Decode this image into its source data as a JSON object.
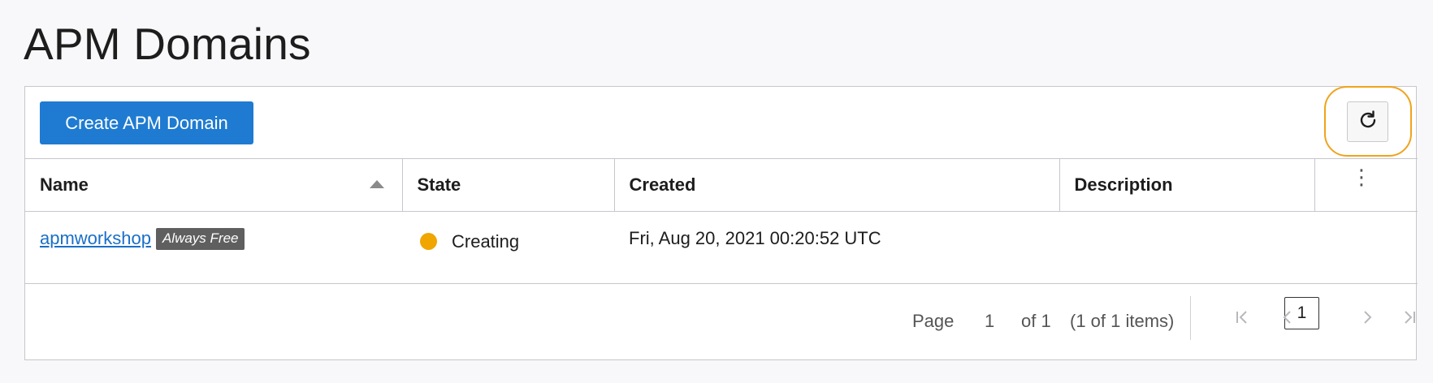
{
  "page": {
    "title": "APM Domains"
  },
  "toolbar": {
    "create_label": "Create APM Domain",
    "refresh_icon": "refresh-icon"
  },
  "table": {
    "columns": [
      "Name",
      "State",
      "Created",
      "Description"
    ],
    "sorted_column": "Name",
    "sort_direction": "ascending",
    "rows": [
      {
        "name": "apmworkshop",
        "badge": "Always Free",
        "state": "Creating",
        "state_color": "#f0a500",
        "created": "Fri, Aug 20, 2021 00:20:52 UTC",
        "description": ""
      }
    ]
  },
  "pagination": {
    "page_label": "Page",
    "page_number": "1",
    "of_label": "of 1",
    "items_label": "(1 of 1 items)",
    "current_page": "1"
  },
  "colors": {
    "primary_button": "#1f7bd1",
    "highlight": "#f0a31c",
    "link": "#1a6fc7"
  }
}
